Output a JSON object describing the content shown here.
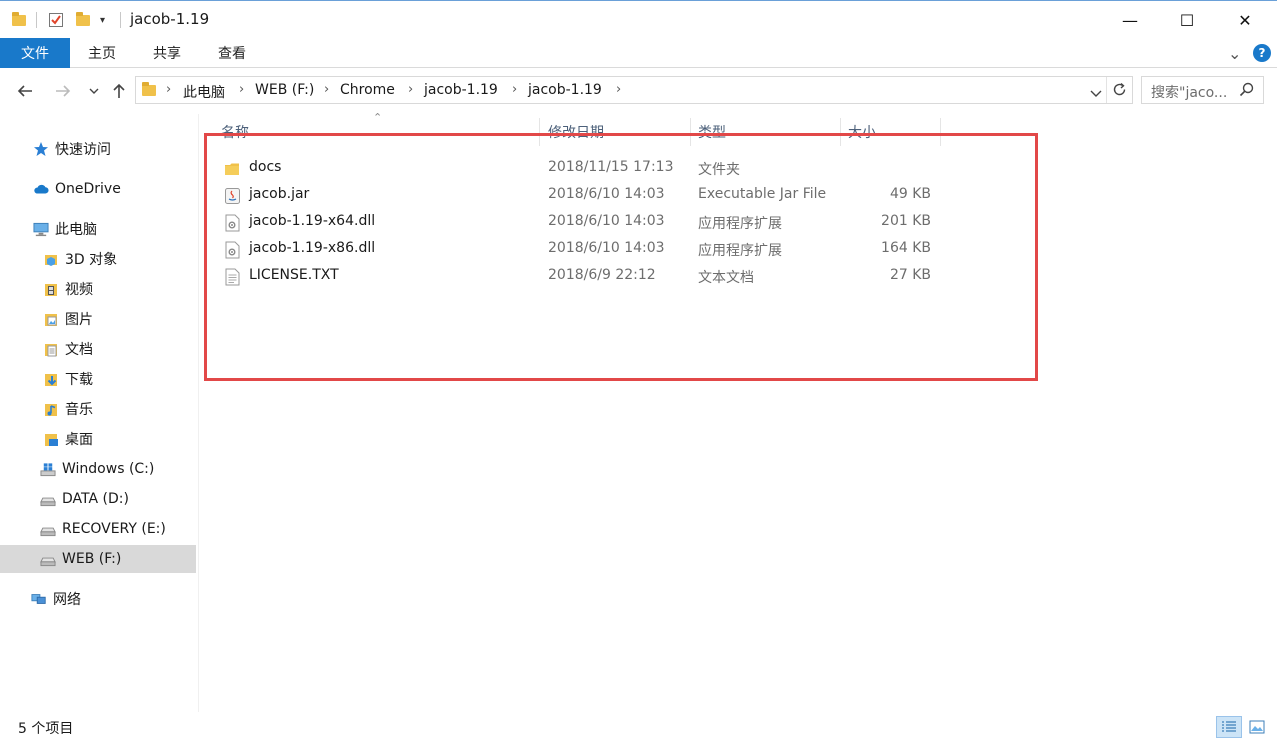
{
  "window": {
    "title": "jacob-1.19",
    "minimize_glyph": "—",
    "maximize_glyph": "☐",
    "close_glyph": "✕"
  },
  "ribbon": {
    "tabs": [
      "文件",
      "主页",
      "共享",
      "查看"
    ],
    "expand_glyph": "⌄",
    "help_glyph": "?"
  },
  "address": {
    "crumbs": [
      "此电脑",
      "WEB (F:)",
      "Chrome",
      "jacob-1.19",
      "jacob-1.19"
    ],
    "search_placeholder": "搜索\"jaco..."
  },
  "columns": {
    "name": "名称",
    "date": "修改日期",
    "type": "类型",
    "size": "大小"
  },
  "files": [
    {
      "name": "docs",
      "date": "2018/11/15 17:13",
      "type": "文件夹",
      "size": "",
      "icon": "folder-icon"
    },
    {
      "name": "jacob.jar",
      "date": "2018/6/10 14:03",
      "type": "Executable Jar File",
      "size": "49 KB",
      "icon": "jar-icon"
    },
    {
      "name": "jacob-1.19-x64.dll",
      "date": "2018/6/10 14:03",
      "type": "应用程序扩展",
      "size": "201 KB",
      "icon": "dll-icon"
    },
    {
      "name": "jacob-1.19-x86.dll",
      "date": "2018/6/10 14:03",
      "type": "应用程序扩展",
      "size": "164 KB",
      "icon": "dll-icon"
    },
    {
      "name": "LICENSE.TXT",
      "date": "2018/6/9 22:12",
      "type": "文本文档",
      "size": "27 KB",
      "icon": "text-file-icon"
    }
  ],
  "sidebar": {
    "quick_access": "快速访问",
    "onedrive": "OneDrive",
    "this_pc": "此电脑",
    "items": [
      "3D 对象",
      "视频",
      "图片",
      "文档",
      "下载",
      "音乐",
      "桌面",
      "Windows (C:)",
      "DATA (D:)",
      "RECOVERY (E:)",
      "WEB (F:)"
    ],
    "network": "网络"
  },
  "status": {
    "item_count": "5 个项目"
  },
  "colors": {
    "accent": "#1979ca",
    "highlight_border": "#e24848",
    "folder": "#f0c14a"
  }
}
